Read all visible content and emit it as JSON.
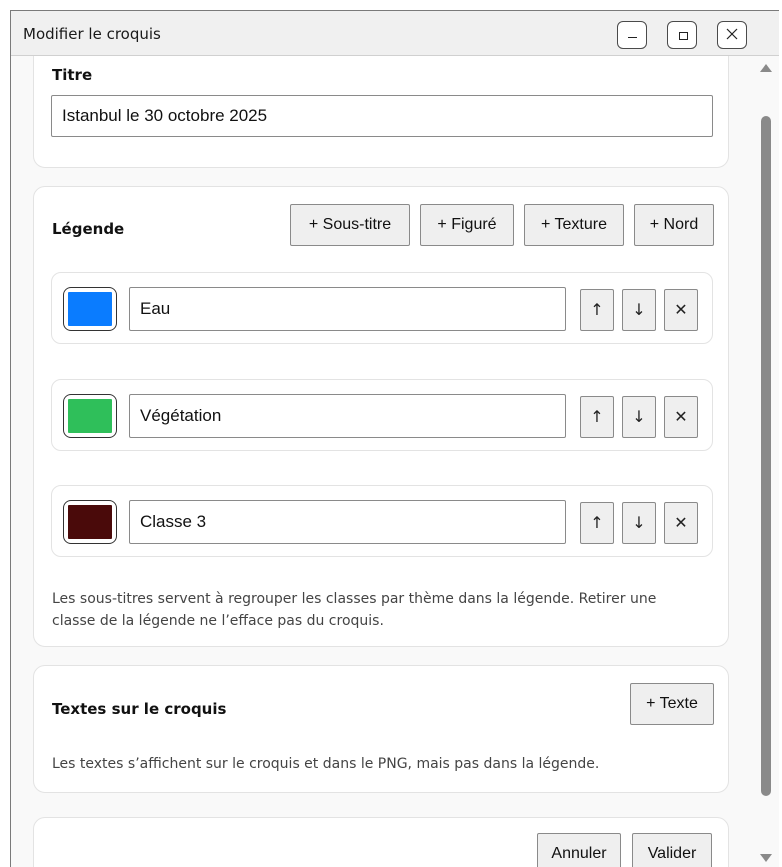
{
  "window": {
    "title": "Modifier le croquis",
    "controls": {
      "minimize": "–",
      "close": "✕"
    }
  },
  "titre": {
    "label": "Titre",
    "value": "Istanbul le 30 octobre 2025"
  },
  "legende": {
    "label": "Légende",
    "buttons": [
      "+ Sous-titre",
      "+ Figuré",
      "+ Texture",
      "+ Nord"
    ],
    "items": [
      {
        "label": "Eau",
        "color": "#0a7cff"
      },
      {
        "label": "Végétation",
        "color": "#2fbf5a"
      },
      {
        "label": "Classe 3",
        "color": "#4a0a0a"
      }
    ],
    "row_controls": {
      "up": "↑",
      "down": "↓",
      "remove": "✕"
    },
    "help_line1": "Les sous-titres servent à regrouper les classes par thème dans la légende. Retirer une",
    "help_line2": "classe de la légende ne l’efface pas du croquis."
  },
  "textes": {
    "label": "Textes sur le croquis",
    "add_button": "+ Texte",
    "help": "Les textes s’affichent sur le croquis et dans le PNG, mais pas dans la légende."
  },
  "footer": {
    "cancel": "Annuler",
    "validate": "Valider"
  }
}
